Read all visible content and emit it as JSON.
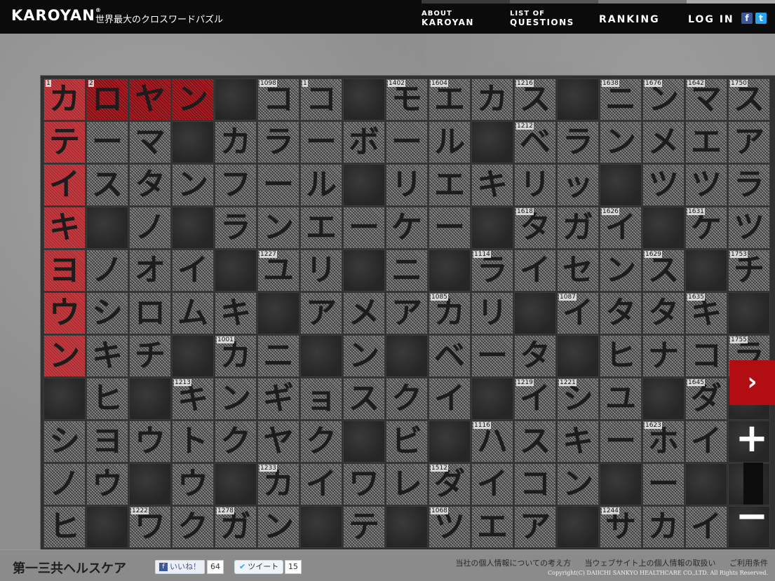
{
  "header": {
    "logo": "KAROYAN",
    "logo_mark": "®",
    "tagline": "世界最大のクロスワードパズル",
    "nav": [
      {
        "small": "ABOUT",
        "big": "KAROYAN"
      },
      {
        "small": "LIST OF",
        "big": "QUESTIONS"
      },
      {
        "single": "RANKING"
      },
      {
        "single": "LOG IN"
      }
    ],
    "social": {
      "facebook": "f",
      "twitter": "t"
    }
  },
  "grid": {
    "rows": [
      [
        "カR",
        "ロR",
        "ヤR",
        "ンR",
        "#",
        "コ",
        "コ",
        "#",
        "モ",
        "エ",
        "カ",
        "ス",
        "#",
        "ニ",
        "ン",
        "マ",
        "ス"
      ],
      [
        "テR",
        "ー",
        "マ",
        "#",
        "カ",
        "ラ",
        "ー",
        "ボ",
        "ー",
        "ル",
        "#",
        "ベ",
        "ラ",
        "ン",
        "メ",
        "エ",
        "ア"
      ],
      [
        "イR",
        "ス",
        "タ",
        "ン",
        "フ",
        "ー",
        "ル",
        "#",
        "リ",
        "エ",
        "キ",
        "リ",
        "ッ",
        "#",
        "ツ",
        "ツ",
        "ラ"
      ],
      [
        "キR",
        "#",
        "ノ",
        "#",
        "ラ",
        "ン",
        "エ",
        "ー",
        "ケ",
        "ー",
        "#",
        "タ",
        "ガ",
        "イ",
        "#",
        "ケ",
        "ツ"
      ],
      [
        "ヨR",
        "ノ",
        "オ",
        "イ",
        "#",
        "ユ",
        "リ",
        "#",
        "ニ",
        "#",
        "ラ",
        "イ",
        "セ",
        "ン",
        "ス",
        "#",
        "チ"
      ],
      [
        "ウR",
        "シ",
        "ロ",
        "ム",
        "キ",
        "#",
        "ア",
        "メ",
        "ア",
        "カ",
        "リ",
        "#",
        "イ",
        "タ",
        "タ",
        "キ",
        "#"
      ],
      [
        "ンR",
        "キ",
        "チ",
        "#",
        "カ",
        "ニ",
        "#",
        "ン",
        "#",
        "ベ",
        "ー",
        "タ",
        "#",
        "ヒ",
        "ナ",
        "コ",
        "ラ"
      ],
      [
        "#",
        "ヒ",
        "#",
        "キ",
        "ン",
        "ギ",
        "ョ",
        "ス",
        "ク",
        "イ",
        "#",
        "イ",
        "シ",
        "ユ",
        "#",
        "ダ",
        "#"
      ],
      [
        "シ",
        "ヨ",
        "ウ",
        "ト",
        "ク",
        "ヤ",
        "ク",
        "#",
        "ビ",
        "#",
        "ハ",
        "ス",
        "キ",
        "ー",
        "ホ",
        "イ",
        "#"
      ],
      [
        "ノ",
        "ウ",
        "#",
        "ウ",
        "#",
        "カ",
        "イ",
        "ワ",
        "レ",
        "ダ",
        "イ",
        "コ",
        "ン",
        "#",
        "ー",
        "#",
        "#"
      ],
      [
        "ヒ",
        "#",
        "ワ",
        "ク",
        "ガ",
        "ン",
        "#",
        "テ",
        "#",
        "ツ",
        "エ",
        "ア",
        "#",
        "サ",
        "カ",
        "イ",
        "#"
      ]
    ],
    "numbers": [
      {
        "r": 0,
        "c": 0,
        "n": "1"
      },
      {
        "r": 0,
        "c": 1,
        "n": "2"
      },
      {
        "r": 0,
        "c": 5,
        "n": "1098"
      },
      {
        "r": 0,
        "c": 6,
        "n": "1"
      },
      {
        "r": 0,
        "c": 8,
        "n": "1402"
      },
      {
        "r": 0,
        "c": 9,
        "n": "1604"
      },
      {
        "r": 0,
        "c": 11,
        "n": "1216"
      },
      {
        "r": 0,
        "c": 13,
        "n": "1638"
      },
      {
        "r": 0,
        "c": 14,
        "n": "1676"
      },
      {
        "r": 0,
        "c": 15,
        "n": "1642"
      },
      {
        "r": 0,
        "c": 16,
        "n": "1750"
      },
      {
        "r": 1,
        "c": 11,
        "n": "1212"
      },
      {
        "r": 3,
        "c": 11,
        "n": "1618"
      },
      {
        "r": 3,
        "c": 13,
        "n": "1626"
      },
      {
        "r": 3,
        "c": 15,
        "n": "1631"
      },
      {
        "r": 4,
        "c": 5,
        "n": "1227"
      },
      {
        "r": 4,
        "c": 10,
        "n": "1114"
      },
      {
        "r": 4,
        "c": 14,
        "n": "1629"
      },
      {
        "r": 4,
        "c": 16,
        "n": "1753"
      },
      {
        "r": 5,
        "c": 9,
        "n": "1085"
      },
      {
        "r": 5,
        "c": 12,
        "n": "1087"
      },
      {
        "r": 5,
        "c": 15,
        "n": "1635"
      },
      {
        "r": 6,
        "c": 4,
        "n": "1001"
      },
      {
        "r": 6,
        "c": 16,
        "n": "1755"
      },
      {
        "r": 7,
        "c": 3,
        "n": "1213"
      },
      {
        "r": 7,
        "c": 11,
        "n": "1219"
      },
      {
        "r": 7,
        "c": 12,
        "n": "1221"
      },
      {
        "r": 7,
        "c": 15,
        "n": "1645"
      },
      {
        "r": 8,
        "c": 10,
        "n": "1116"
      },
      {
        "r": 8,
        "c": 14,
        "n": "1623"
      },
      {
        "r": 9,
        "c": 5,
        "n": "1233"
      },
      {
        "r": 9,
        "c": 9,
        "n": "1512"
      },
      {
        "r": 10,
        "c": 2,
        "n": "1222"
      },
      {
        "r": 10,
        "c": 4,
        "n": "1278"
      },
      {
        "r": 10,
        "c": 9,
        "n": "1068"
      },
      {
        "r": 10,
        "c": 13,
        "n": "1244"
      }
    ]
  },
  "controls": {
    "next": "›",
    "zoom_in": "+",
    "zoom_out": "−"
  },
  "footer": {
    "brand": "第一三共ヘルスケア",
    "like_label": "いいね！",
    "like_count": "64",
    "tweet_label": "ツイート",
    "tweet_count": "15",
    "links": [
      "当社の個人情報についての考え方",
      "当ウェブサイト上の個人情報の取扱い",
      "ご利用条件"
    ],
    "copyright": "Copyright(C) DAIICHI SANKYO HEALTHCARE CO.,LTD. All Rights Reserved."
  },
  "colors": {
    "accent_red": "#b30d14",
    "header_bg": "#0b0b0b"
  }
}
